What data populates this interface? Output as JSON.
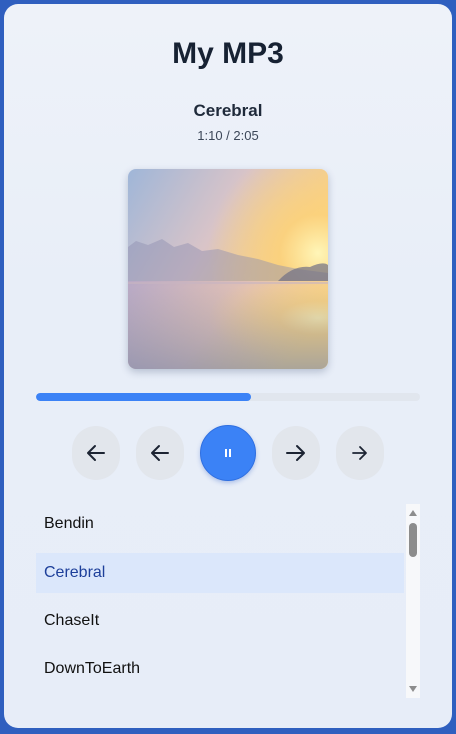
{
  "app": {
    "title": "My MP3"
  },
  "now_playing": {
    "track": "Cerebral",
    "time": "1:10 / 2:05",
    "artwork": "misty-lake-sunrise-artwork",
    "progress_fraction": 0.56,
    "is_playing": true
  },
  "controls": [
    {
      "name": "skip-back-button",
      "icon": "arrow-left-icon"
    },
    {
      "name": "previous-button",
      "icon": "arrow-left-icon"
    },
    {
      "name": "play-pause-button",
      "icon": "pause-icon"
    },
    {
      "name": "next-button",
      "icon": "arrow-right-icon"
    },
    {
      "name": "skip-forward-button",
      "icon": "arrow-right-icon"
    }
  ],
  "playlist": {
    "items": [
      "Bendin",
      "Cerebral",
      "ChaseIt",
      "DownToEarth"
    ],
    "selected": "Cerebral"
  },
  "colors": {
    "accent": "#3b82f6",
    "selected_bg": "#dbe7fb",
    "window_border": "#2f5fbf"
  }
}
